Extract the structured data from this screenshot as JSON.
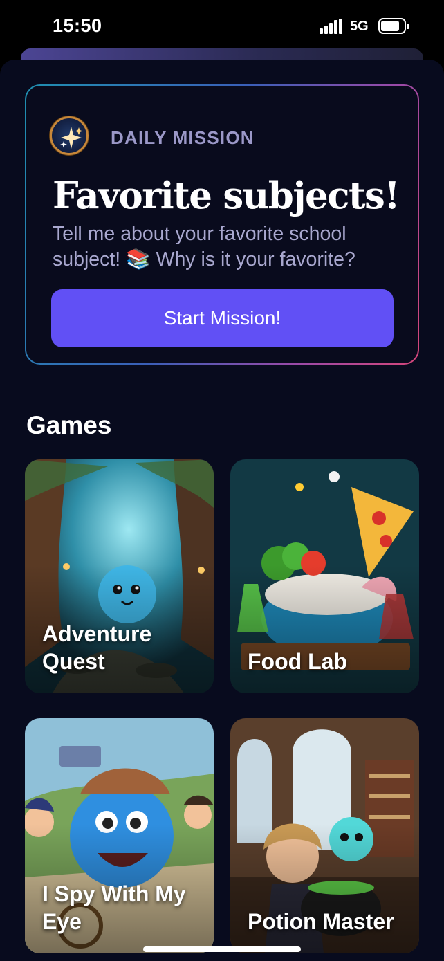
{
  "status_bar": {
    "time": "15:50",
    "network": "5G"
  },
  "mission": {
    "kicker": "DAILY MISSION",
    "title": "Favorite subjects!",
    "description": "Tell me about your favorite school subject! 📚 Why is it your favorite?",
    "button_label": "Start Mission!",
    "badge_icon": "sparkles-icon"
  },
  "games": {
    "heading": "Games",
    "items": [
      {
        "label": "Adventure Quest"
      },
      {
        "label": "Food Lab"
      },
      {
        "label": "I Spy With My Eye"
      },
      {
        "label": "Potion Master"
      }
    ]
  },
  "colors": {
    "background": "#080b1e",
    "accent_button": "#6150f5",
    "kicker_text": "#9b98c8",
    "description_text": "#a9a8cf"
  }
}
